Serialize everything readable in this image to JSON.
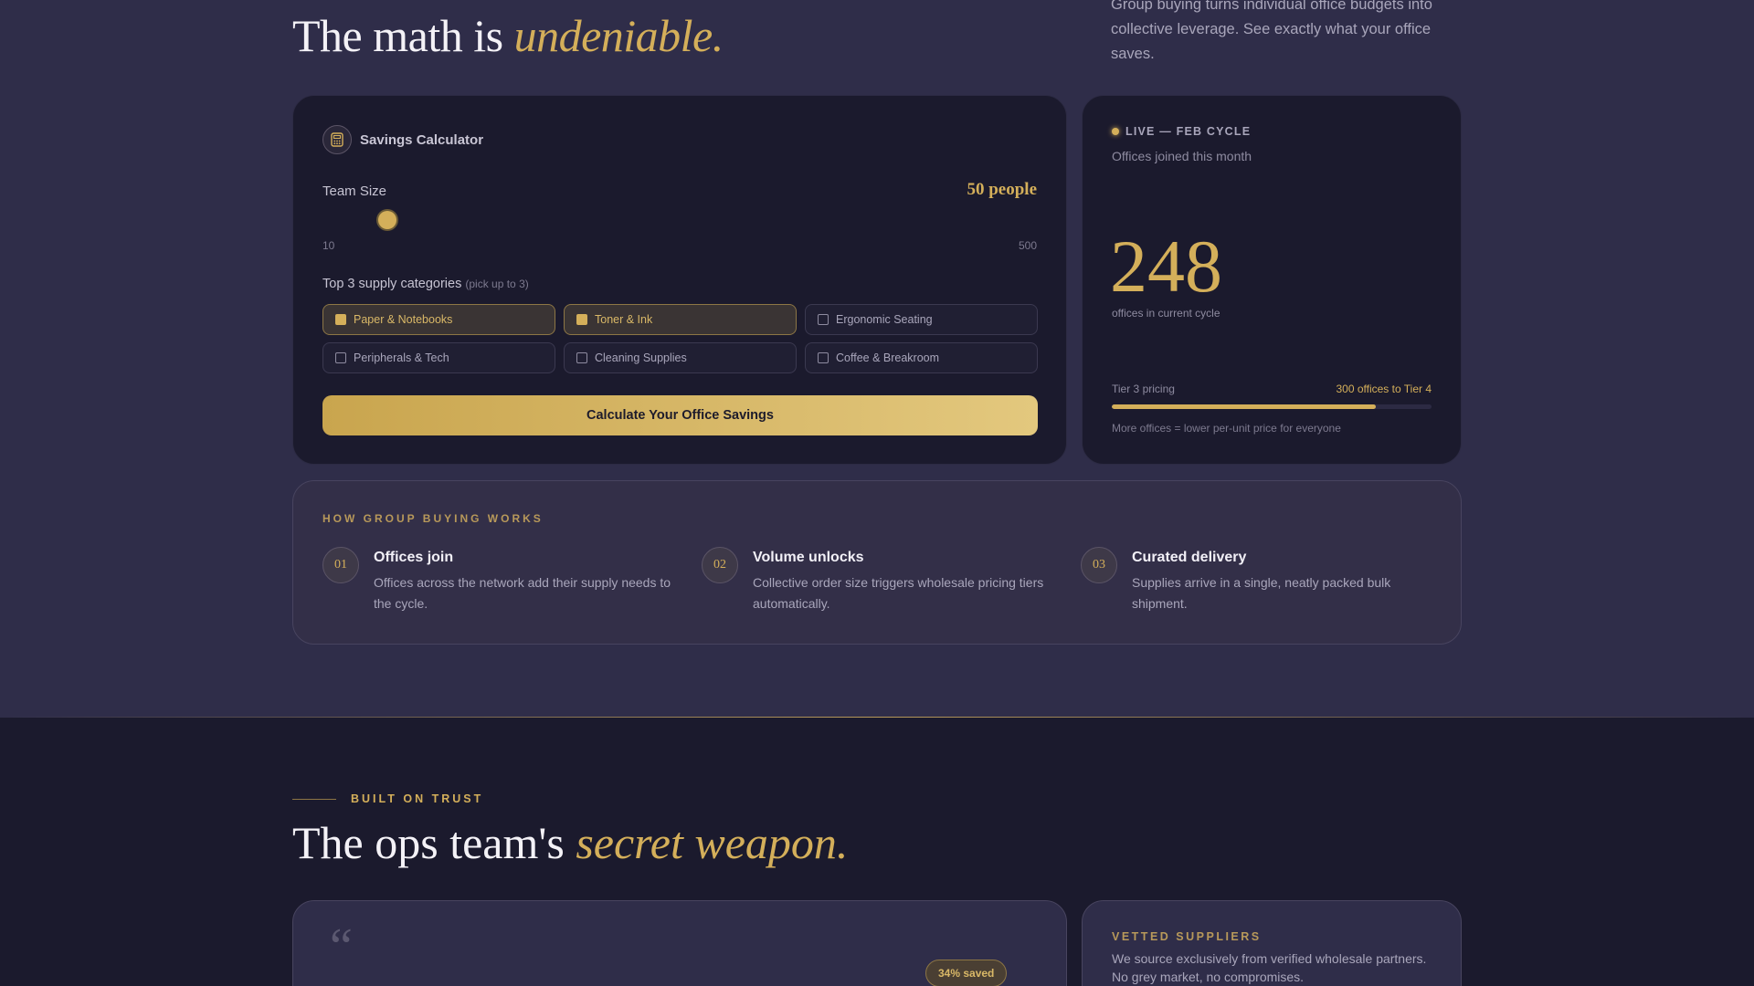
{
  "hero": {
    "title_plain": "The math is ",
    "title_accent": "undeniable.",
    "intro": "Group buying turns individual office budgets into collective leverage. See exactly what your office saves."
  },
  "calculator": {
    "title": "Savings Calculator",
    "icon": "calculator-icon",
    "team_label": "Team Size",
    "team_value": "50 people",
    "slider_value": 50,
    "slider_min": "10",
    "slider_max": "500",
    "categories_label": "Top 3 supply categories",
    "categories_hint": "(pick up to 3)",
    "categories": [
      {
        "label": "Paper & Notebooks",
        "checked": true
      },
      {
        "label": "Toner & Ink",
        "checked": true
      },
      {
        "label": "Ergonomic Seating",
        "checked": false
      },
      {
        "label": "Peripherals & Tech",
        "checked": false
      },
      {
        "label": "Cleaning Supplies",
        "checked": false
      },
      {
        "label": "Coffee & Breakroom",
        "checked": false
      }
    ],
    "cta": "Calculate Your Office Savings"
  },
  "live": {
    "tag": "LIVE — FEB CYCLE",
    "subtitle": "Offices joined this month",
    "count": "248",
    "count_caption": "offices in current cycle",
    "tier_label": "Tier 3 pricing",
    "tier_next": "300 offices to Tier 4",
    "progress_fraction": 0.827,
    "note": "More offices = lower per-unit price for everyone"
  },
  "how": {
    "title": "HOW GROUP BUYING WORKS",
    "steps": [
      {
        "num": "01",
        "title": "Offices join",
        "desc": "Offices across the network add their supply needs to the cycle."
      },
      {
        "num": "02",
        "title": "Volume unlocks",
        "desc": "Collective order size triggers wholesale pricing tiers automatically."
      },
      {
        "num": "03",
        "title": "Curated delivery",
        "desc": "Supplies arrive in a single, neatly packed bulk shipment."
      }
    ]
  },
  "trust": {
    "eyebrow": "BUILT ON TRUST",
    "title_plain": "The ops team's ",
    "title_accent": "secret weapon.",
    "quote_mark": "“",
    "saved_badge": "34% saved",
    "vetted_title": "VETTED SUPPLIERS",
    "vetted_desc": "We source exclusively from verified wholesale partners. No grey market, no compromises."
  },
  "colors": {
    "accent": "#d4af5a",
    "background": "#2f2d49",
    "card": "#1b1a2d"
  }
}
